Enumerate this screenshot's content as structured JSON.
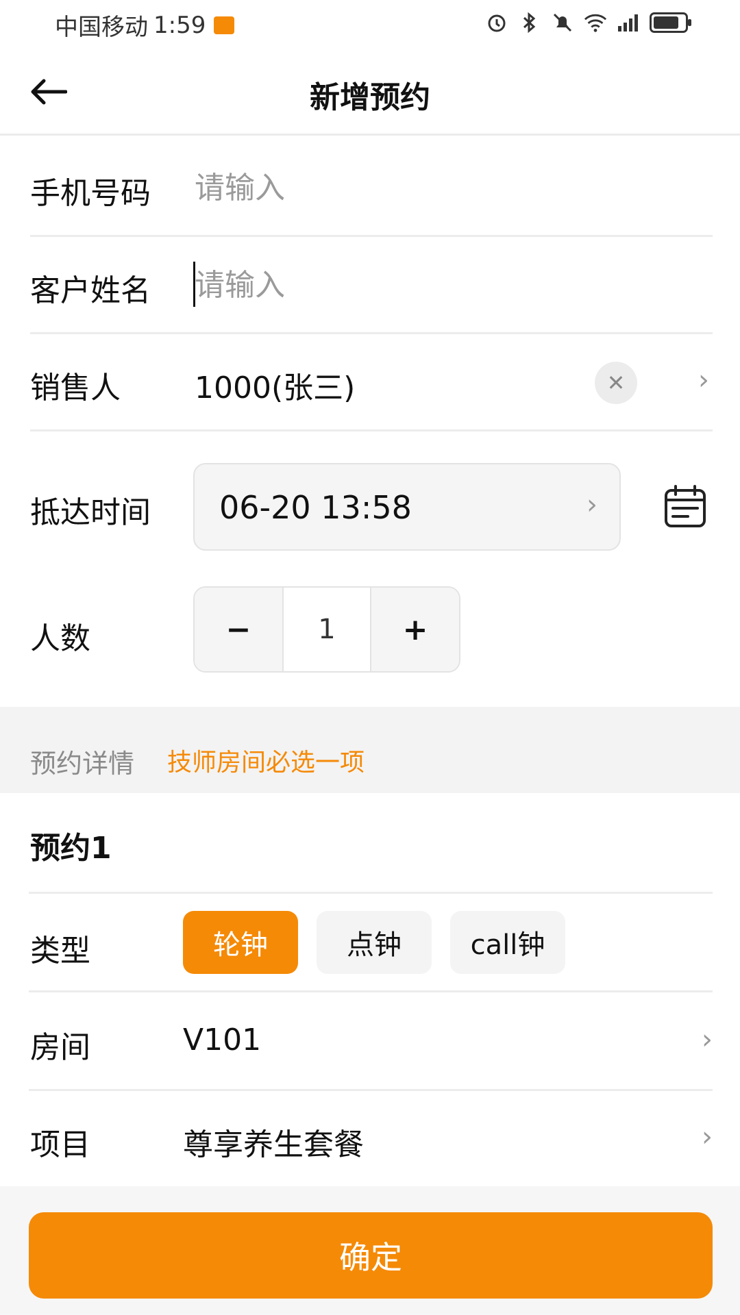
{
  "status_bar": {
    "carrier": "中国移动",
    "time": "1:59"
  },
  "header": {
    "title": "新增预约"
  },
  "form": {
    "phone": {
      "label": "手机号码",
      "placeholder": "请输入",
      "value": ""
    },
    "name": {
      "label": "客户姓名",
      "placeholder": "请输入",
      "value": ""
    },
    "salesperson": {
      "label": "销售人",
      "value": "1000(张三)"
    },
    "arrival": {
      "label": "抵达时间",
      "value": "06-20 13:58"
    },
    "guests": {
      "label": "人数",
      "value": "1",
      "minus": "−",
      "plus": "+"
    }
  },
  "section": {
    "title": "预约详情",
    "hint": "技师房间必选一项"
  },
  "booking": {
    "title": "预约1",
    "type": {
      "label": "类型",
      "options": [
        "轮钟",
        "点钟",
        "call钟"
      ],
      "selected": "轮钟"
    },
    "room": {
      "label": "房间",
      "value": "V101"
    },
    "item": {
      "label": "项目",
      "value": "尊享养生套餐"
    }
  },
  "footer": {
    "confirm": "确定"
  },
  "colors": {
    "accent": "#f58a07",
    "divider": "#ececec",
    "section_bg": "#f3f3f3"
  }
}
